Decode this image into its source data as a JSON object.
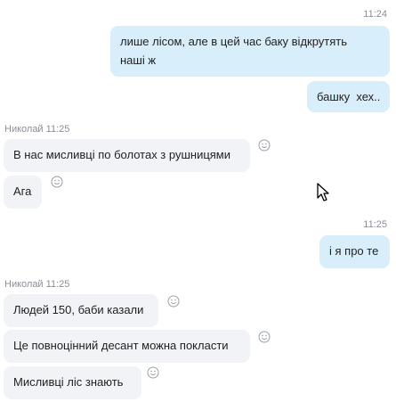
{
  "messages": {
    "out1": {
      "time": "11:24",
      "lines": [
        "лише лісом, але в цей час баку відкрутять",
        "наші ж"
      ]
    },
    "out2": {
      "text": "башку  хех.."
    },
    "in1": {
      "sender": "Николай",
      "time": "11:25",
      "text": "В нас мисливці по болотах з рушницями"
    },
    "in2": {
      "text": "Ага"
    },
    "out3": {
      "time": "11:25",
      "text": "і я про те"
    },
    "in3": {
      "sender": "Николай",
      "time": "11:25",
      "text": "Людей 150, баби казали"
    },
    "in4": {
      "text": "Це повноцінний десант можна покласти"
    },
    "in5": {
      "text": "Мисливці ліс знають"
    }
  },
  "icons": {
    "reaction": "smiley-icon",
    "cursor": "mouse-pointer-icon"
  },
  "colors": {
    "outgoing_bubble": "#d9eefb",
    "incoming_bubble": "#f1f3f6",
    "meta_text": "#8a8f96"
  }
}
